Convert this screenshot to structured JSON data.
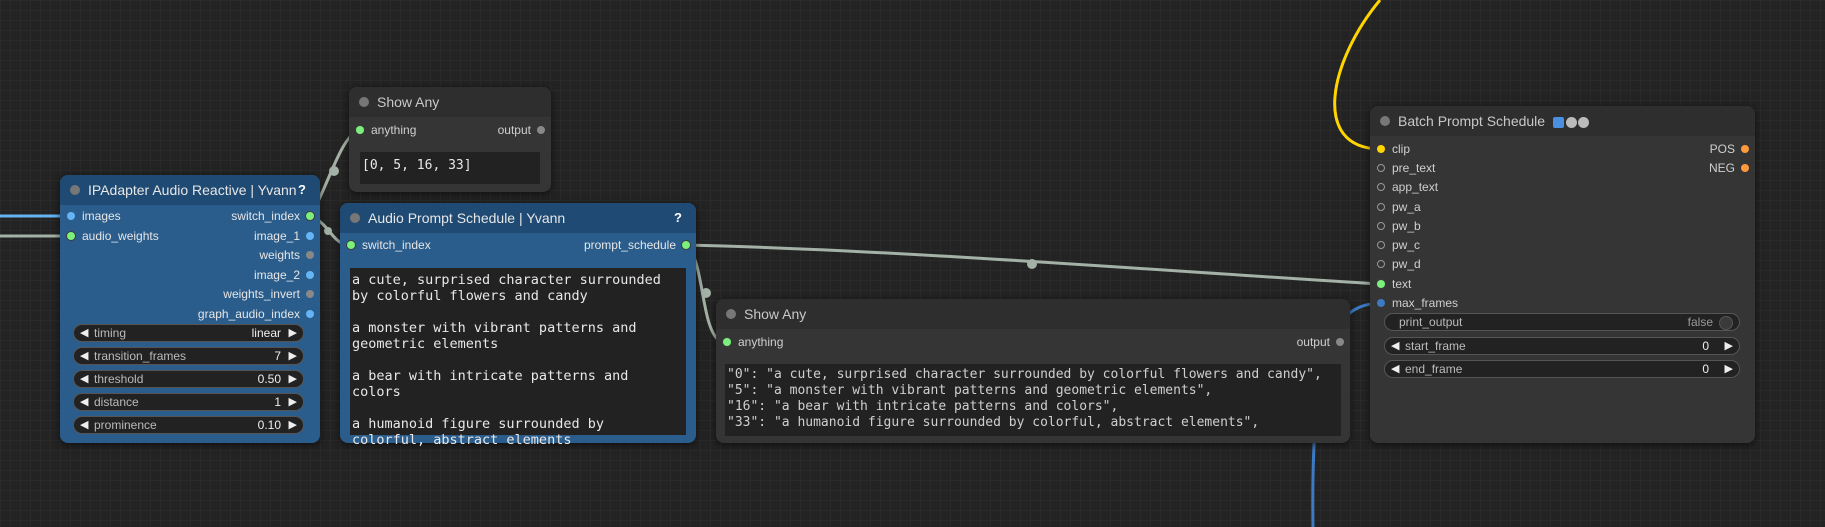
{
  "colors": {
    "yellow_wire": "#ffd500",
    "blue_wire": "#64b5f6",
    "gray_wire": "#a3b1a6",
    "canvas": "#232323"
  },
  "show_any_top": {
    "title": "Show Any",
    "input": "anything",
    "output": "output",
    "value": "[0, 5, 16, 33]"
  },
  "ipadapter": {
    "title": "IPAdapter Audio Reactive | Yvann",
    "help": "?",
    "inputs": [
      "images",
      "audio_weights"
    ],
    "outputs": [
      "switch_index",
      "image_1",
      "weights",
      "image_2",
      "weights_invert",
      "graph_audio_index"
    ],
    "widgets": [
      {
        "label": "timing",
        "value": "linear"
      },
      {
        "label": "transition_frames",
        "value": "7"
      },
      {
        "label": "threshold",
        "value": "0.50"
      },
      {
        "label": "distance",
        "value": "1"
      },
      {
        "label": "prominence",
        "value": "0.10"
      }
    ]
  },
  "audio_prompt": {
    "title": "Audio Prompt Schedule | Yvann",
    "help": "?",
    "input": "switch_index",
    "output": "prompt_schedule",
    "text": "a cute, surprised character surrounded by colorful flowers and candy\n\na monster with vibrant patterns and geometric elements\n\na bear with intricate patterns and colors\n\na humanoid figure surrounded by colorful, abstract elements"
  },
  "show_any_mid": {
    "title": "Show Any",
    "input": "anything",
    "output": "output",
    "value": "\"0\": \"a cute, surprised character surrounded by colorful flowers and candy\",\n\"5\": \"a monster with vibrant patterns and geometric elements\",\n\"16\": \"a bear with intricate patterns and colors\",\n\"33\": \"a humanoid figure surrounded by colorful, abstract elements\","
  },
  "batch": {
    "title": "Batch Prompt Schedule",
    "inputs": [
      "clip",
      "pre_text",
      "app_text",
      "pw_a",
      "pw_b",
      "pw_c",
      "pw_d",
      "text",
      "max_frames"
    ],
    "outputs": [
      "POS",
      "NEG"
    ],
    "widgets": [
      {
        "label": "print_output",
        "value": "false"
      },
      {
        "label": "start_frame",
        "value": "0"
      },
      {
        "label": "end_frame",
        "value": "0"
      }
    ]
  }
}
